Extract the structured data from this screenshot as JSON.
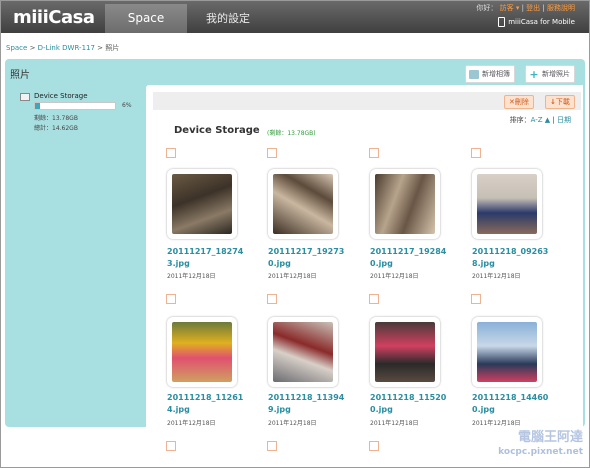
{
  "app": {
    "logo": "miiiCasa"
  },
  "nav": {
    "tabs": [
      "Space",
      "我的設定"
    ]
  },
  "toplinks": {
    "greeting": "你好：",
    "user": "訪客 ▾",
    "logout": "登出",
    "help": "服務說明",
    "mobile": "miiiCasa for Mobile"
  },
  "breadcrumb": {
    "root": "Space",
    "sep1": " > ",
    "device": "D-Link DWR-117",
    "sep2": " > ",
    "current": "照片"
  },
  "panel": {
    "title": "照片",
    "new_album": "新增相簿",
    "new_photo": "新增照片"
  },
  "sidebar": {
    "device_name": "Device Storage",
    "usage_percent": 6,
    "usage_label": "6%",
    "remaining": "剩餘：13.78GB",
    "total": "總計：14.62GB"
  },
  "toolbar": {
    "delete": "刪除",
    "download": "下載"
  },
  "sort": {
    "label": "排序：",
    "az": "A-Z ▲",
    "sep": " | ",
    "date": "日期"
  },
  "storage": {
    "title": "Device Storage",
    "remaining": "(剩餘：13.78GB)"
  },
  "photos": [
    {
      "name": "20111217_182743.jpg",
      "date": "2011年12月18日"
    },
    {
      "name": "20111217_192730.jpg",
      "date": "2011年12月18日"
    },
    {
      "name": "20111217_192840.jpg",
      "date": "2011年12月18日"
    },
    {
      "name": "20111218_092638.jpg",
      "date": "2011年12月18日"
    },
    {
      "name": "20111218_112614.jpg",
      "date": "2011年12月18日"
    },
    {
      "name": "20111218_113949.jpg",
      "date": "2011年12月18日"
    },
    {
      "name": "20111218_115200.jpg",
      "date": "2011年12月18日"
    },
    {
      "name": "20111218_144600.jpg",
      "date": "2011年12月18日"
    }
  ],
  "watermark": {
    "line1": "電腦王阿達",
    "line2": "kocpc.pixnet.net"
  }
}
